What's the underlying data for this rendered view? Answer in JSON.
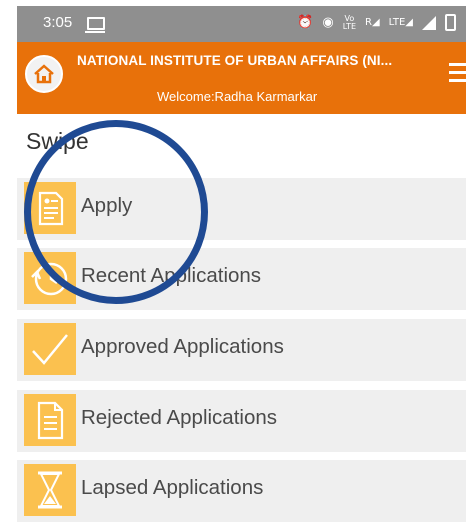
{
  "status_bar": {
    "time": "3:05",
    "volte_label": "Vo\nLTE",
    "r_label": "R",
    "lte_label": "LTE"
  },
  "header": {
    "title": "NATIONAL INSTITUTE OF URBAN AFFAIRS (NI...",
    "welcome": "Welcome:Radha Karmarkar"
  },
  "section": {
    "label": "Swipe"
  },
  "menu": {
    "items": [
      {
        "label": "Apply",
        "icon": "form-icon"
      },
      {
        "label": "Recent Applications",
        "icon": "history-icon"
      },
      {
        "label": "Approved Applications",
        "icon": "checkmark-icon"
      },
      {
        "label": "Rejected Applications",
        "icon": "document-icon"
      },
      {
        "label": "Lapsed Applications",
        "icon": "hourglass-icon"
      }
    ]
  },
  "colors": {
    "header_bg": "#e8710a",
    "icon_bg": "#fbc14f",
    "item_bg": "#efefef",
    "status_bar_bg": "#8f8f8f",
    "annotation": "#1f4a93"
  }
}
